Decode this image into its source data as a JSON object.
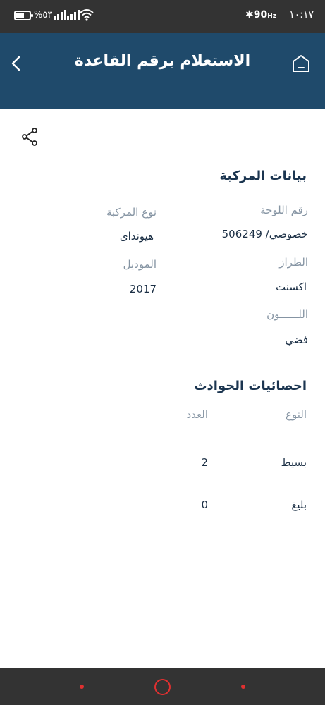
{
  "status_bar": {
    "time": "١٠:١٧",
    "bluetooth_refresh": "90",
    "refresh_unit": "Hz",
    "battery": "%٥٣",
    "battery_level": 0.53,
    "icons": [
      "battery-icon",
      "signal-icon",
      "signal-icon",
      "wifi-icon",
      "bluetooth-icon"
    ]
  },
  "header": {
    "title": "الاستعلام برقم القاعدة",
    "home_icon": "home-icon",
    "back_icon": "chevron-left-icon",
    "color": "#1f4a6b"
  },
  "share_icon": "share-icon",
  "vehicle": {
    "section_title": "بيانات المركبة",
    "plate_label": "رقم اللوحة",
    "plate_value": "خصوصي/ 506249",
    "type_label": "نوع المركبة",
    "type_value": "هيونداى",
    "trim_label": "الطراز",
    "trim_value": "اكسنت",
    "model_label": "الموديل",
    "model_value": "2017",
    "color_label": "اللــــــون",
    "color_value": "فضي"
  },
  "accidents": {
    "section_title": "احصائيات الحوادث",
    "headers": {
      "type": "النوع",
      "count": "العدد"
    },
    "rows": [
      {
        "type": "بسيط",
        "count": "2"
      },
      {
        "type": "بليغ",
        "count": "0"
      }
    ]
  },
  "nav_bar": {
    "accent": "#e03030",
    "icons": [
      "recent-apps-icon",
      "home-button-icon",
      "back-button-icon"
    ]
  }
}
